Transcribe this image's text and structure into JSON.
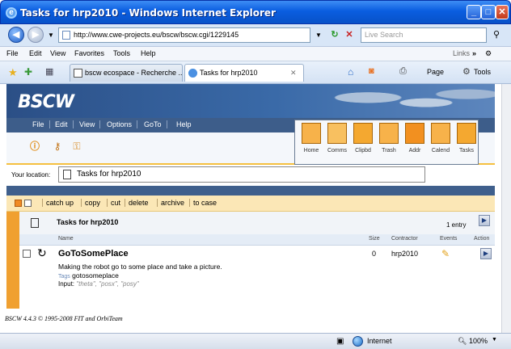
{
  "window": {
    "title": "Tasks for hrp2010 - Windows Internet Explorer",
    "controls": {
      "minimize": "_",
      "maximize": "□",
      "close": "✕"
    }
  },
  "address_bar": {
    "url": "http://www.cwe-projects.eu/bscw/bscw.cgi/1229145",
    "search_placeholder": "Live Search"
  },
  "menu": {
    "items": [
      "File",
      "Edit",
      "View",
      "Favorites",
      "Tools",
      "Help"
    ],
    "links_label": "Links"
  },
  "tabs": [
    {
      "label": "bscw ecospace - Recherche ...",
      "active": false
    },
    {
      "label": "Tasks for hrp2010",
      "active": true
    }
  ],
  "toolbar_right": {
    "page_label": "Page",
    "tools_label": "Tools"
  },
  "bscw": {
    "logo": "BSCW",
    "menu": [
      "File",
      "Edit",
      "View",
      "Options",
      "GoTo",
      "Help"
    ],
    "action_icons": [
      {
        "label": "Home",
        "icon": "home-icon"
      },
      {
        "label": "Comms",
        "icon": "people-icon"
      },
      {
        "label": "Clipbd",
        "icon": "clipboard-icon"
      },
      {
        "label": "Trash",
        "icon": "trash-icon"
      },
      {
        "label": "Addr",
        "icon": "address-book-icon"
      },
      {
        "label": "Calend",
        "icon": "calendar-icon"
      },
      {
        "label": "Tasks",
        "icon": "tasks-icon"
      }
    ],
    "location_label": "Your location:",
    "location_value": "Tasks for hrp2010",
    "actions": [
      "catch up",
      "copy",
      "cut",
      "delete",
      "archive",
      "to case"
    ],
    "list": {
      "title": "Tasks for hrp2010",
      "entry_count": "1 entry",
      "columns": {
        "name": "Name",
        "size": "Size",
        "contractor": "Contractor",
        "events": "Events",
        "action": "Action"
      },
      "rows": [
        {
          "name": "GoToSomePlace",
          "size": "0",
          "contractor": "hrp2010",
          "description": "Making the robot go to some place and take a picture.",
          "tags_label": "Tags",
          "tags": "gotosomeplace",
          "input_label": "Input",
          "input_value": "\"theta\", \"posx\", \"posy\""
        }
      ]
    },
    "footer": "BSCW 4.4.3 © 1995-2008 FIT and OrbiTeam"
  },
  "status_bar": {
    "zone": "Internet",
    "zoom": "100%"
  },
  "colors": {
    "brand_orange": "#f0a030",
    "bscw_blue": "#3d5d8a",
    "ie_blue": "#0a5de0"
  }
}
